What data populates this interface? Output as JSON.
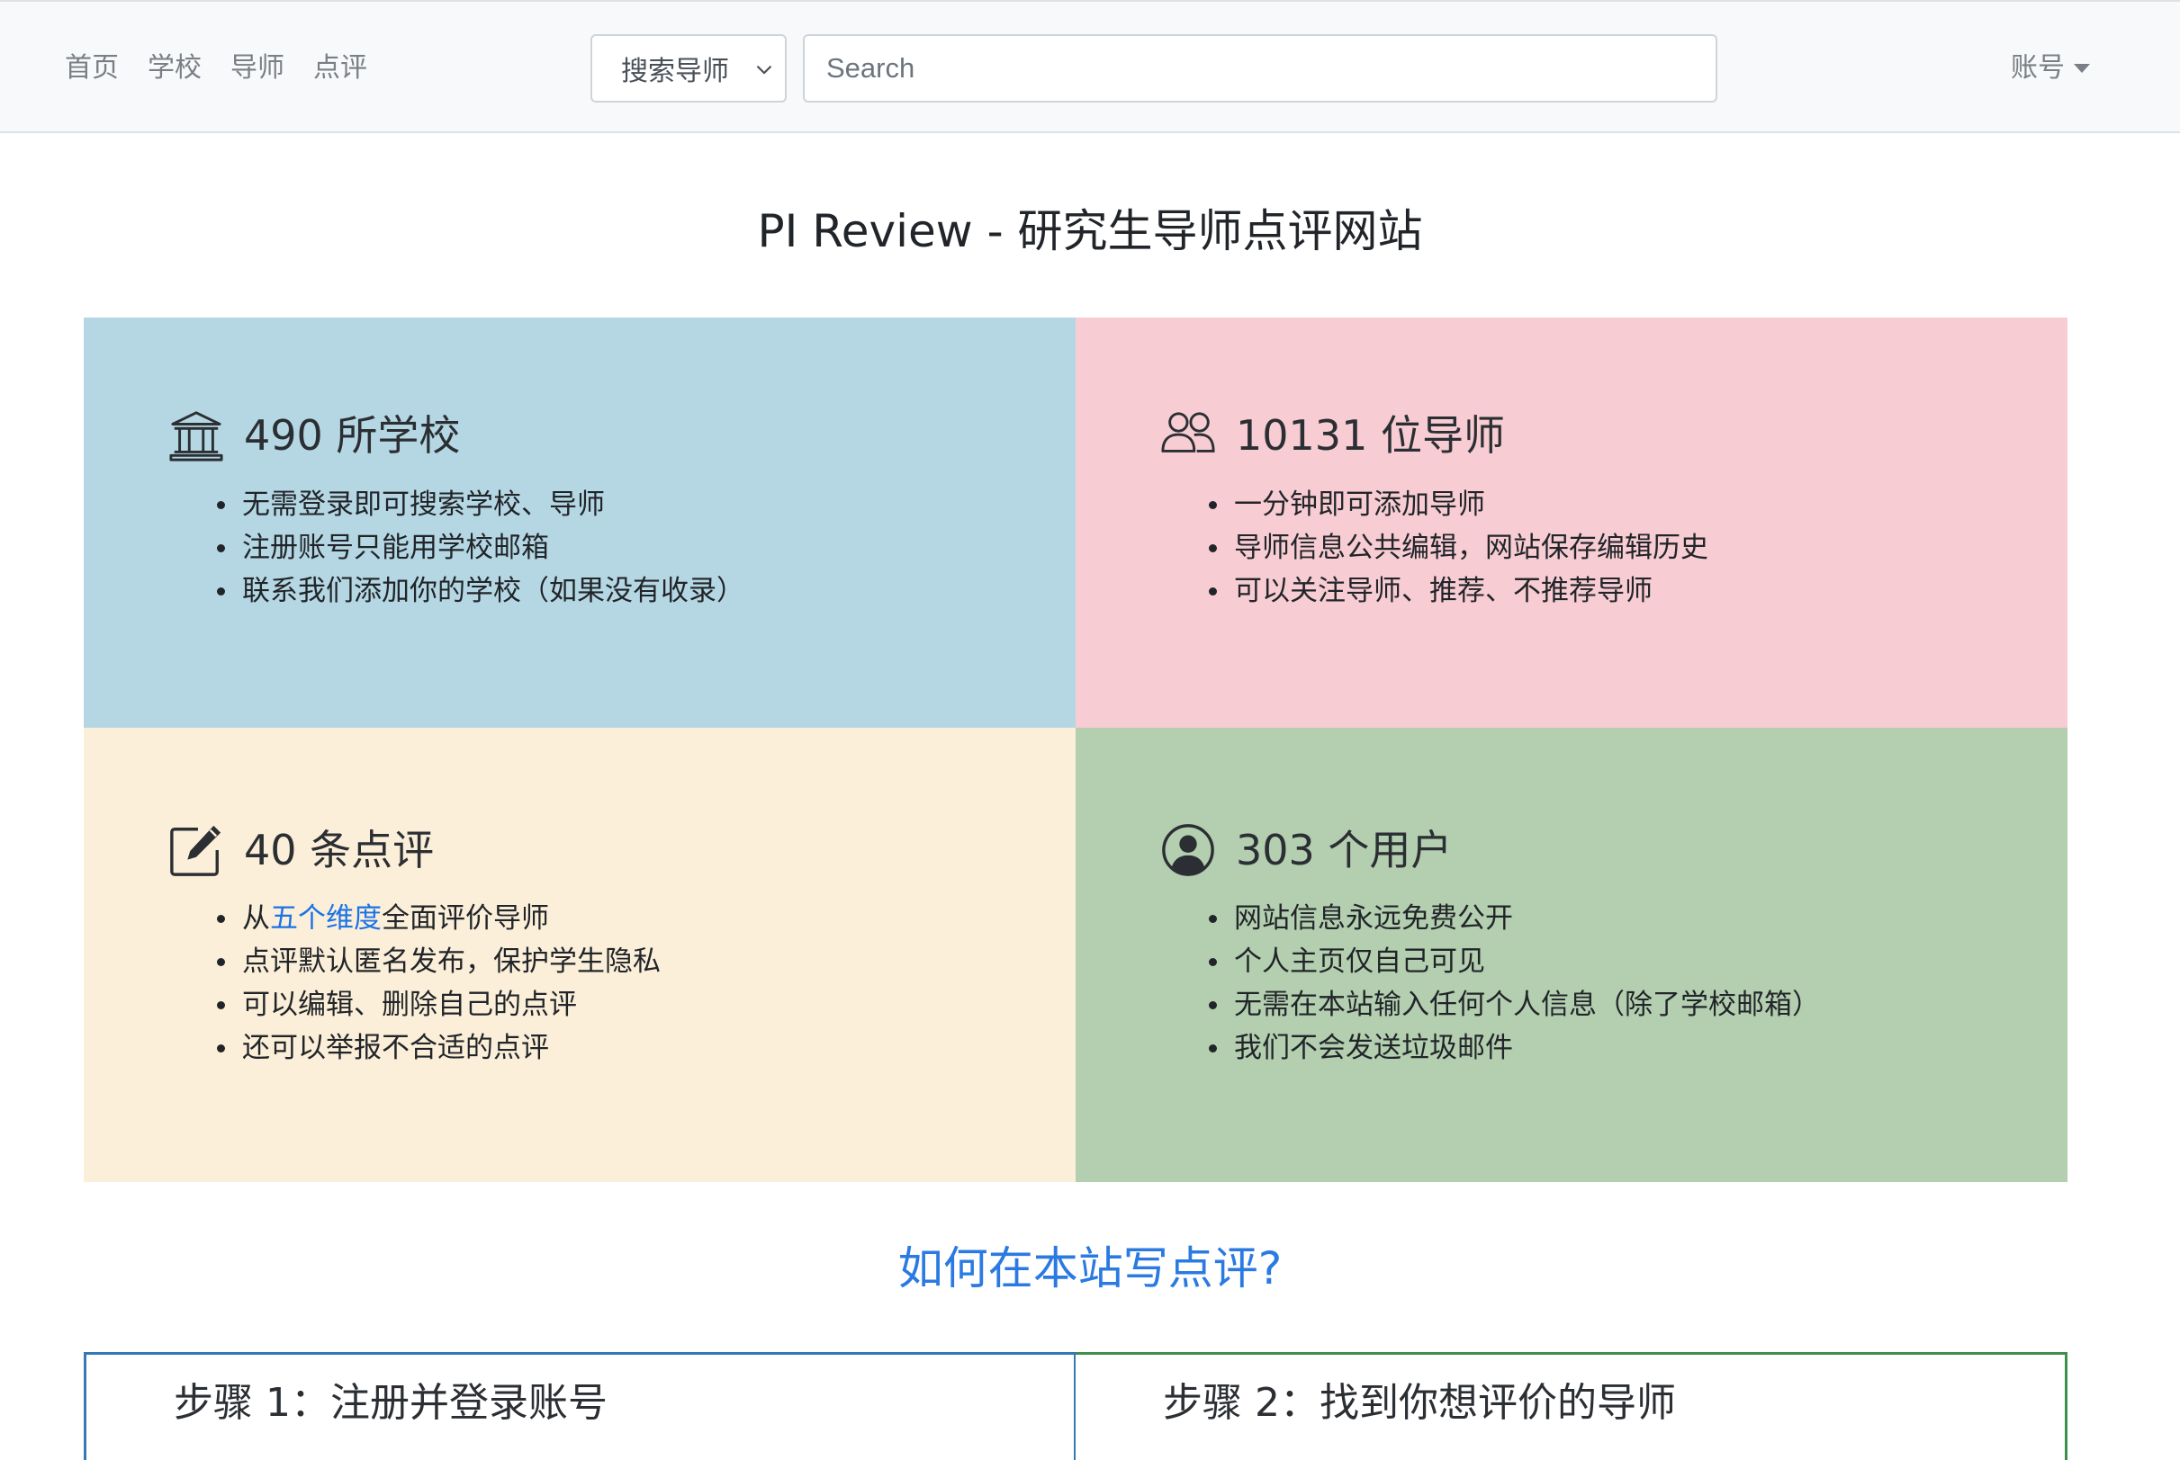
{
  "nav": {
    "links": [
      "首页",
      "学校",
      "导师",
      "点评"
    ],
    "search_type": "搜索导师",
    "search_placeholder": "Search",
    "account": "账号"
  },
  "page": {
    "title": "PI Review - 研究生导师点评网站"
  },
  "cards": [
    {
      "icon": "university-icon",
      "title": "490 所学校",
      "items": [
        "无需登录即可搜索学校、导师",
        "注册账号只能用学校邮箱",
        "联系我们添加你的学校（如果没有收录）"
      ]
    },
    {
      "icon": "people-icon",
      "title": "10131 位导师",
      "items": [
        "一分钟即可添加导师",
        "导师信息公共编辑，网站保存编辑历史",
        "可以关注导师、推荐、不推荐导师"
      ]
    },
    {
      "icon": "edit-icon",
      "title": "40 条点评",
      "items_first": {
        "prefix": "从",
        "link": "五个维度",
        "suffix": "全面评价导师"
      },
      "items": [
        "点评默认匿名发布，保护学生隐私",
        "可以编辑、删除自己的点评",
        "还可以举报不合适的点评"
      ]
    },
    {
      "icon": "user-circle-icon",
      "title": "303 个用户",
      "items": [
        "网站信息永远免费公开",
        "个人主页仅自己可见",
        "无需在本站输入任何个人信息（除了学校邮箱）",
        "我们不会发送垃圾邮件"
      ]
    }
  ],
  "howto": {
    "title": "如何在本站写点评?",
    "steps": [
      "步骤 1：注册并登录账号",
      "步骤 2：找到你想评价的导师"
    ]
  },
  "colors": {
    "card_blue": "#b5d7e4",
    "card_pink": "#f7ccd3",
    "card_cream": "#fcefd9",
    "card_green": "#b4ceb0",
    "link_blue": "#2a7ae2"
  }
}
